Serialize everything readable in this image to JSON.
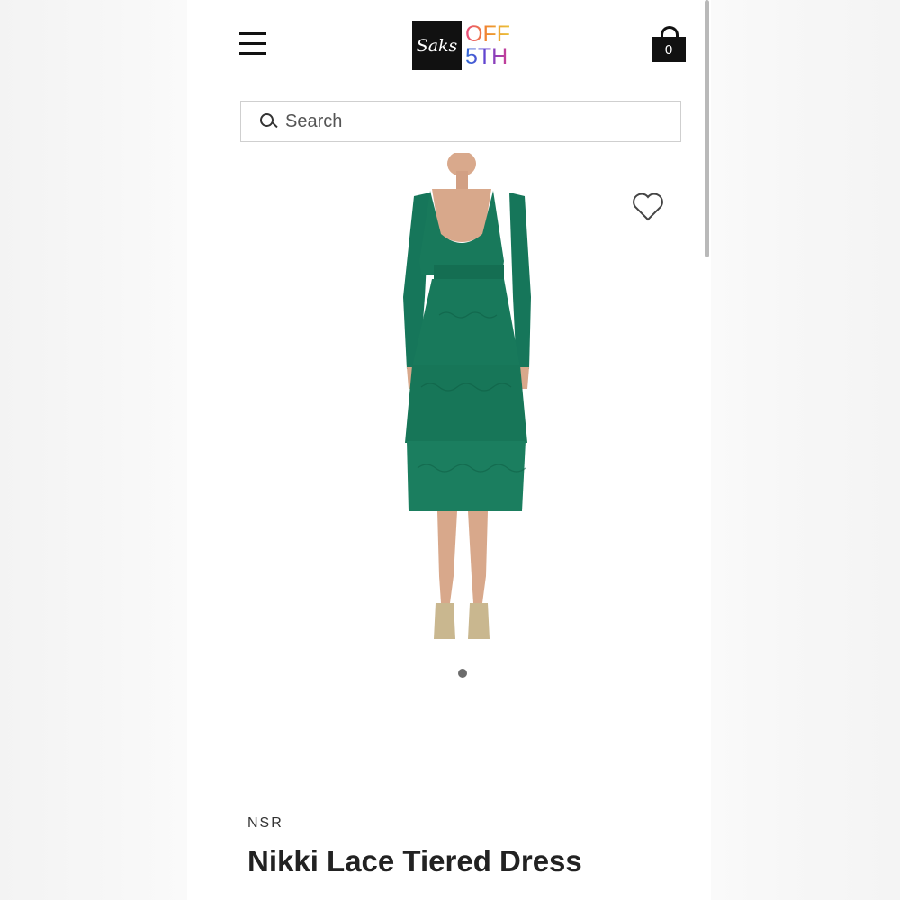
{
  "header": {
    "logo_mark": "Saks",
    "logo_line1": "OFF",
    "logo_line2": "5TH",
    "cart_count": "0"
  },
  "search": {
    "placeholder": "Search"
  },
  "gallery": {
    "image_count": 1,
    "active_index": 0
  },
  "product": {
    "brand": "NSR",
    "title": "Nikki Lace Tiered Dress",
    "dress_color": "#17785a"
  },
  "icons": {
    "menu": "hamburger-menu-icon",
    "cart": "shopping-bag-icon",
    "search": "search-icon",
    "wishlist": "heart-outline-icon"
  }
}
